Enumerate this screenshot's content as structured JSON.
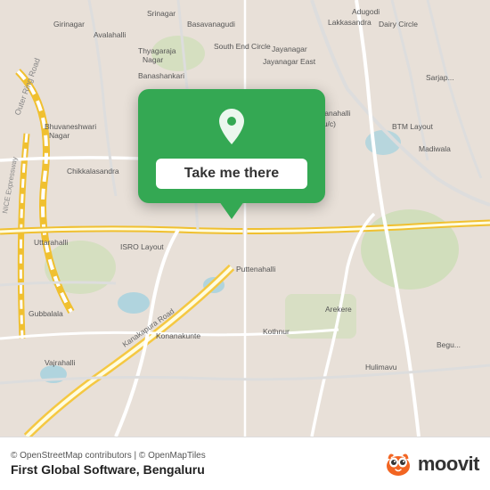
{
  "map": {
    "attribution": "© OpenStreetMap contributors | © OpenMapTiles",
    "center_label": "Puttenahalli"
  },
  "popup": {
    "button_label": "Take me there"
  },
  "footer": {
    "location_name": "First Global Software, Bengaluru",
    "attribution": "© OpenStreetMap contributors | © OpenMapTiles",
    "logo_text": "moovit"
  },
  "colors": {
    "map_bg": "#e8e0d8",
    "green_accent": "#34a853",
    "road_major": "#f5c842",
    "road_minor": "#ffffff",
    "water": "#aad3df",
    "green_area": "#b5d5a0"
  }
}
